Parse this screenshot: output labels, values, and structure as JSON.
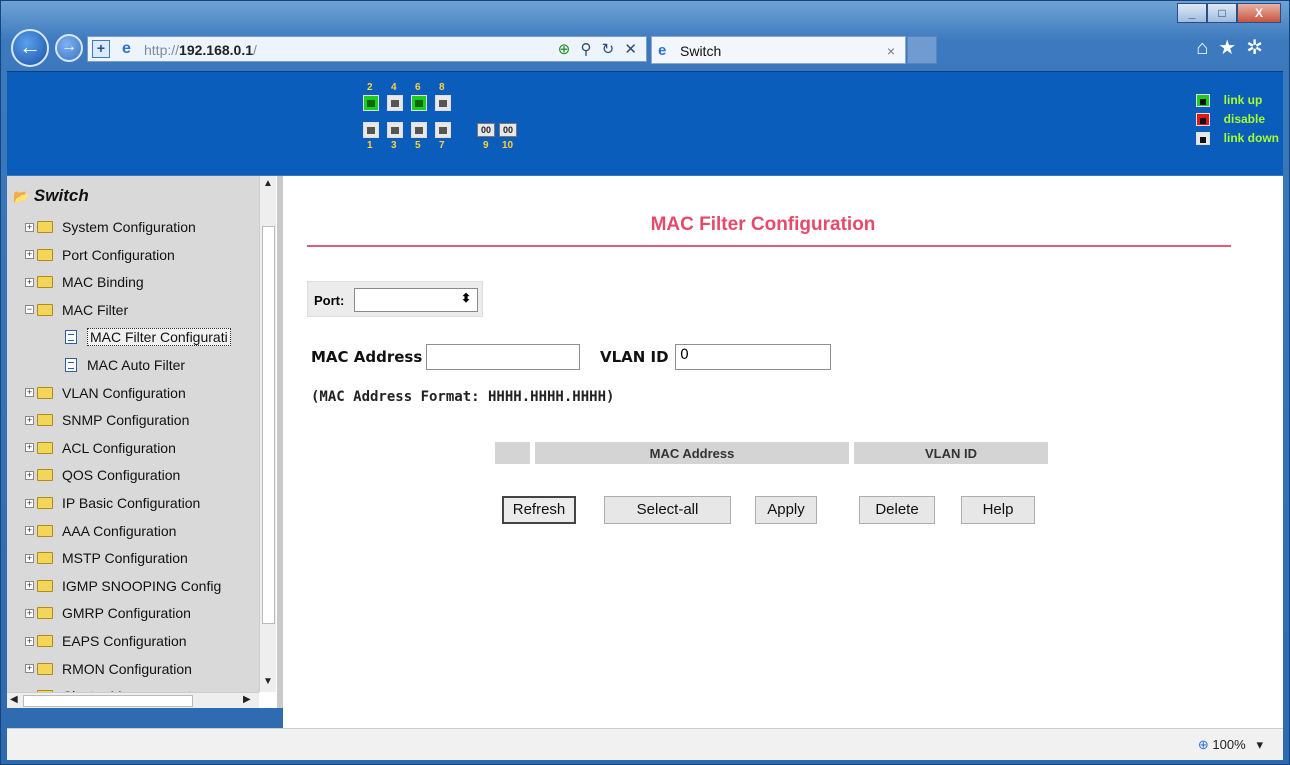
{
  "browser": {
    "window_controls": [
      "_",
      "□",
      "X"
    ],
    "address_prefix": "http://",
    "address_host": "192.168.0.1",
    "address_suffix": "/",
    "tab_title": "Switch",
    "tab_close": "×",
    "zoom_level": "100%",
    "zoom_caret": "▾"
  },
  "banner": {
    "top_port_numbers": [
      "2",
      "4",
      "6",
      "8"
    ],
    "bottom_port_numbers": [
      "1",
      "3",
      "5",
      "7",
      "9",
      "10"
    ],
    "top_port_states": [
      "up",
      "down",
      "up",
      "down"
    ],
    "bottom_port_states": [
      "down",
      "down",
      "down",
      "down"
    ],
    "legend": [
      {
        "label": "link up",
        "color": "#1ecb1e"
      },
      {
        "label": "disable",
        "color": "#e01818"
      },
      {
        "label": "link down",
        "color": "#e8e8e8"
      }
    ]
  },
  "sidebar": {
    "root": "Switch",
    "items": [
      {
        "label": "System Configuration",
        "type": "folder"
      },
      {
        "label": "Port Configuration",
        "type": "folder"
      },
      {
        "label": "MAC Binding",
        "type": "folder"
      },
      {
        "label": "MAC Filter",
        "type": "folder-open"
      },
      {
        "label": "MAC Filter Configurati",
        "type": "doc",
        "selected": true
      },
      {
        "label": "MAC Auto Filter",
        "type": "doc"
      },
      {
        "label": "VLAN Configuration",
        "type": "folder"
      },
      {
        "label": "SNMP Configuration",
        "type": "folder"
      },
      {
        "label": "ACL Configuration",
        "type": "folder"
      },
      {
        "label": "QOS Configuration",
        "type": "folder"
      },
      {
        "label": "IP Basic Configuration",
        "type": "folder"
      },
      {
        "label": "AAA Configuration",
        "type": "folder"
      },
      {
        "label": "MSTP Configuration",
        "type": "folder"
      },
      {
        "label": "IGMP SNOOPING Config",
        "type": "folder"
      },
      {
        "label": "GMRP Configuration",
        "type": "folder"
      },
      {
        "label": "EAPS Configuration",
        "type": "folder"
      },
      {
        "label": "RMON Configuration",
        "type": "folder"
      },
      {
        "label": "Cluster Management",
        "type": "folder"
      }
    ]
  },
  "main": {
    "title": "MAC Filter Configuration",
    "port_label": "Port:",
    "port_value": "",
    "mac_label": "MAC Address",
    "mac_value": "",
    "vlan_label": "VLAN ID",
    "vlan_value": "0",
    "format_hint": "(MAC Address Format: HHHH.HHHH.HHHH)",
    "table_headers": [
      "",
      "MAC Address",
      "VLAN ID"
    ],
    "buttons": {
      "refresh": "Refresh",
      "select_all": "Select-all",
      "apply": "Apply",
      "delete": "Delete",
      "help": "Help"
    }
  }
}
